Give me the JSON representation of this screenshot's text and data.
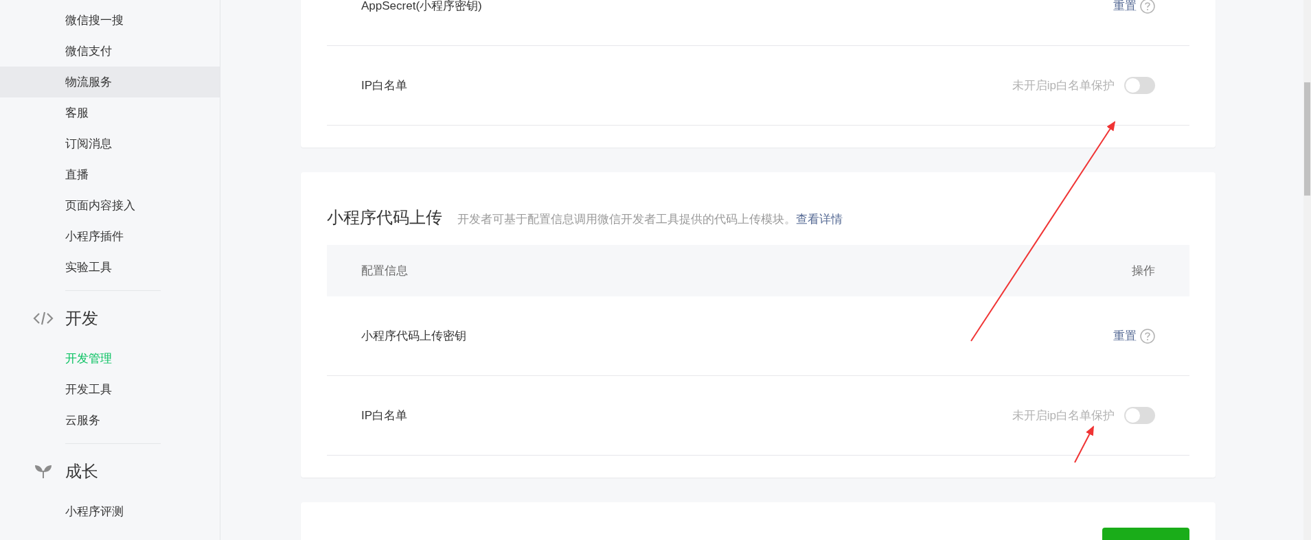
{
  "sidebar": {
    "groups": [
      {
        "items": [
          {
            "label": "微信搜一搜",
            "selected": false,
            "hovered": false
          },
          {
            "label": "微信支付",
            "selected": false,
            "hovered": false
          },
          {
            "label": "物流服务",
            "selected": false,
            "hovered": true
          },
          {
            "label": "客服",
            "selected": false,
            "hovered": false
          },
          {
            "label": "订阅消息",
            "selected": false,
            "hovered": false
          },
          {
            "label": "直播",
            "selected": false,
            "hovered": false
          },
          {
            "label": "页面内容接入",
            "selected": false,
            "hovered": false
          },
          {
            "label": "小程序插件",
            "selected": false,
            "hovered": false
          },
          {
            "label": "实验工具",
            "selected": false,
            "hovered": false
          }
        ]
      },
      {
        "title": "开发",
        "items": [
          {
            "label": "开发管理",
            "selected": true,
            "hovered": false
          },
          {
            "label": "开发工具",
            "selected": false,
            "hovered": false
          },
          {
            "label": "云服务",
            "selected": false,
            "hovered": false
          }
        ]
      },
      {
        "title": "成长",
        "items": [
          {
            "label": "小程序评测",
            "selected": false,
            "hovered": false
          }
        ]
      }
    ]
  },
  "panels": [
    {
      "rows": [
        {
          "kind": "reset",
          "label": "AppSecret(小程序密钥)",
          "action": "重置"
        },
        {
          "kind": "toggle",
          "label": "IP白名单",
          "status": "未开启ip白名单保护",
          "on": false
        }
      ]
    },
    {
      "title": "小程序代码上传",
      "description": "开发者可基于配置信息调用微信开发者工具提供的代码上传模块。",
      "link": "查看详情",
      "columns": [
        "配置信息",
        "操作"
      ],
      "rows": [
        {
          "kind": "reset",
          "label": "小程序代码上传密钥",
          "action": "重置"
        },
        {
          "kind": "toggle",
          "label": "IP白名单",
          "status": "未开启ip白名单保护",
          "on": false
        }
      ]
    },
    {
      "kind": "footer"
    }
  ]
}
